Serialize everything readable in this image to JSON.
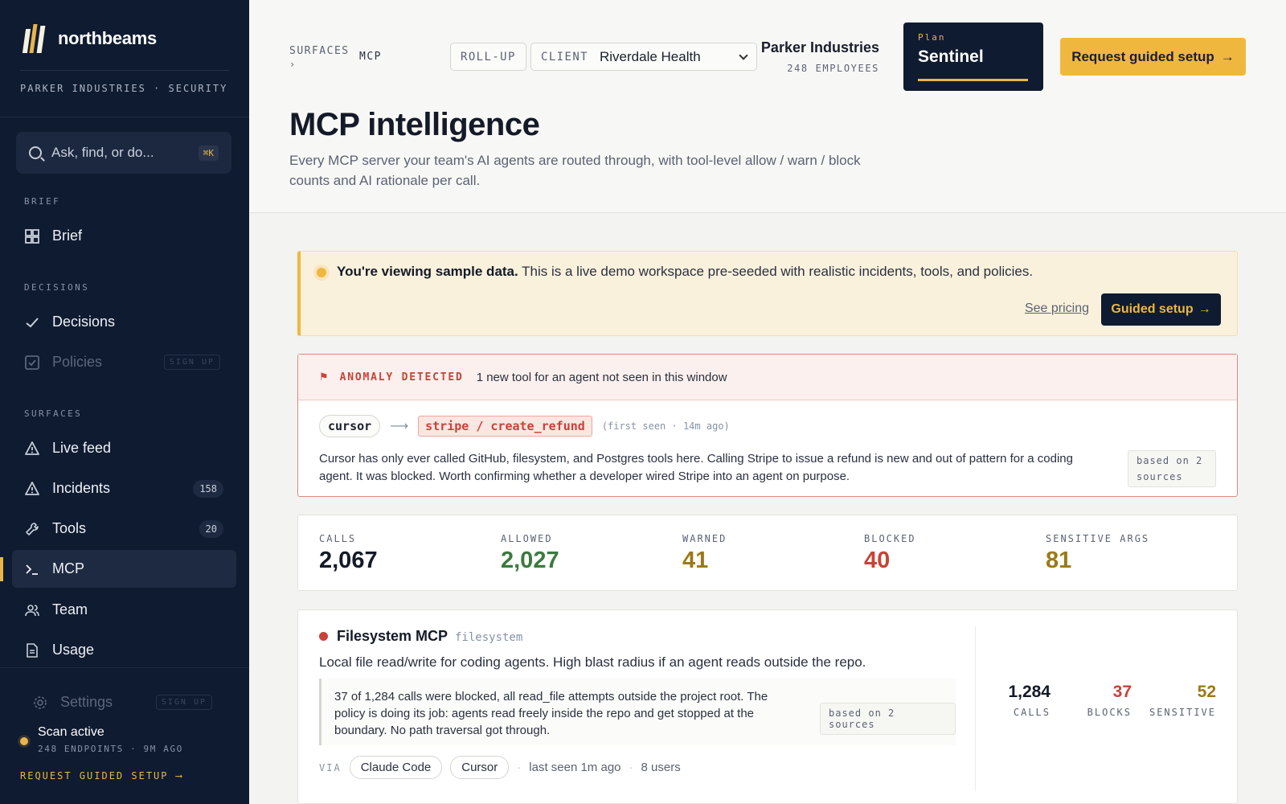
{
  "sidebar": {
    "brand": "northbeams",
    "org_line": "PARKER INDUSTRIES · SECURITY",
    "search": {
      "placeholder": "Ask, find, or do...",
      "shortcut": "⌘K"
    },
    "sections": {
      "brief": "BRIEF",
      "decisions": "DECISIONS",
      "surfaces": "SURFACES"
    },
    "items": {
      "brief": {
        "label": "Brief",
        "icon": "grid-icon"
      },
      "decisions": {
        "label": "Decisions",
        "icon": "check-icon"
      },
      "policies": {
        "label": "Policies",
        "icon": "checkbox-icon",
        "tag": "SIGN UP"
      },
      "live_feed": {
        "label": "Live feed",
        "icon": "warning-icon"
      },
      "incidents": {
        "label": "Incidents",
        "icon": "warning-icon",
        "count": "158"
      },
      "tools": {
        "label": "Tools",
        "icon": "wrench-icon",
        "count": "20"
      },
      "mcp": {
        "label": "MCP",
        "icon": "terminal-icon"
      },
      "team": {
        "label": "Team",
        "icon": "users-icon"
      },
      "usage": {
        "label": "Usage",
        "icon": "document-icon"
      },
      "settings": {
        "label": "Settings",
        "icon": "gear-icon",
        "tag": "SIGN UP"
      }
    },
    "scan": {
      "title": "Scan active",
      "sub": "248 ENDPOINTS · 9M AGO"
    },
    "cta": "REQUEST GUIDED SETUP ⟶"
  },
  "topbar": {
    "crumb_parent": "SURFACES",
    "crumb_current": "MCP",
    "rollup": "ROLL-UP",
    "client_label": "CLIENT",
    "client_value": "Riverdale Health",
    "org_name": "Parker Industries",
    "org_employees": "248 EMPLOYEES",
    "plan_label": "Plan",
    "plan_name": "Sentinel",
    "request_btn": "Request guided setup"
  },
  "page": {
    "title": "MCP intelligence",
    "subtitle": "Every MCP server your team's AI agents are routed through, with tool-level allow / warn / block counts and AI rationale per call."
  },
  "banner": {
    "bold": "You're viewing sample data.",
    "text": " This is a live demo workspace pre-seeded with realistic incidents, tools, and policies.",
    "see_pricing": "See pricing",
    "guided_btn": "Guided setup"
  },
  "anomaly": {
    "label": "ANOMALY DETECTED",
    "message": "1 new tool for an agent not seen in this window",
    "agent": "cursor",
    "tool": "stripe / create_refund",
    "first_seen": "(first seen · 14m ago)",
    "description": "Cursor has only ever called GitHub, filesystem, and Postgres tools here. Calling Stripe to issue a refund is new and out of pattern for a coding agent. It was blocked. Worth confirming whether a developer wired Stripe into an agent on purpose.",
    "based_on": "based on 2 sources"
  },
  "stats": {
    "calls": {
      "label": "CALLS",
      "value": "2,067",
      "color": "#141a28"
    },
    "allowed": {
      "label": "ALLOWED",
      "value": "2,027",
      "color": "#3a7a3e"
    },
    "warned": {
      "label": "WARNED",
      "value": "41",
      "color": "#9a7a18"
    },
    "blocked": {
      "label": "BLOCKED",
      "value": "40",
      "color": "#c84238"
    },
    "sensitive": {
      "label": "SENSITIVE ARGS",
      "value": "81",
      "color": "#9a7a18"
    }
  },
  "server": {
    "name": "Filesystem MCP",
    "slug": "filesystem",
    "description": "Local file read/write for coding agents. High blast radius if an agent reads outside the repo.",
    "quote": "37 of 1,284 calls were blocked, all read_file attempts outside the project root. The policy is doing its job: agents read freely inside the repo and get stopped at the boundary. No path traversal got through.",
    "based_on": "based on 2 sources",
    "via_label": "VIA",
    "via": [
      "Claude Code",
      "Cursor"
    ],
    "last_seen": "last seen 1m ago",
    "users": "8 users",
    "calls": {
      "value": "1,284",
      "label": "CALLS"
    },
    "blocks": {
      "value": "37",
      "label": "BLOCKS"
    },
    "sensitive": {
      "value": "52",
      "label": "SENSITIVE"
    }
  }
}
